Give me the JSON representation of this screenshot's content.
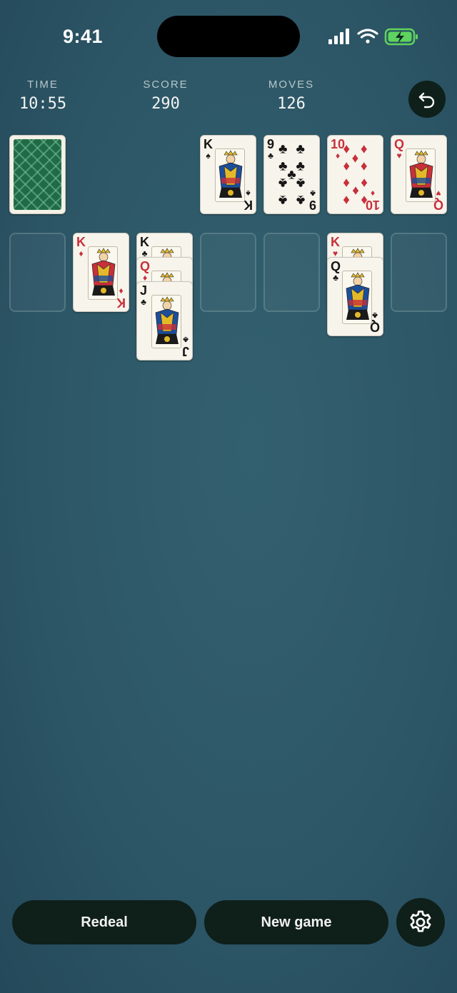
{
  "status_bar": {
    "time": "9:41"
  },
  "stats": [
    {
      "label": "TIME",
      "value": "10:55"
    },
    {
      "label": "SCORE",
      "value": "290"
    },
    {
      "label": "MOVES",
      "value": "126"
    }
  ],
  "foundations": [
    {
      "rank": "K",
      "suit": "♠",
      "color": "black"
    },
    {
      "rank": "9",
      "suit": "♣",
      "color": "black"
    },
    {
      "rank": "10",
      "suit": "♦",
      "color": "red"
    },
    {
      "rank": "Q",
      "suit": "♥",
      "color": "red"
    }
  ],
  "tableau": [
    [],
    [
      {
        "rank": "K",
        "suit": "♦",
        "color": "red"
      }
    ],
    [
      {
        "rank": "K",
        "suit": "♣",
        "color": "black"
      },
      {
        "rank": "Q",
        "suit": "♦",
        "color": "red"
      },
      {
        "rank": "J",
        "suit": "♣",
        "color": "black"
      }
    ],
    [],
    [],
    [
      {
        "rank": "K",
        "suit": "♥",
        "color": "red"
      },
      {
        "rank": "Q",
        "suit": "♣",
        "color": "black"
      }
    ],
    []
  ],
  "buttons": {
    "redeal": "Redeal",
    "new_game": "New game"
  },
  "icons": {
    "undo": "undo-arrow-icon",
    "settings": "gear-icon",
    "card_back": "card-back-pattern"
  },
  "colors": {
    "background": "#2d5767",
    "button_bg": "#0f1f1a",
    "card_red": "#c8303a",
    "card_back_green": "#1f6b48"
  }
}
